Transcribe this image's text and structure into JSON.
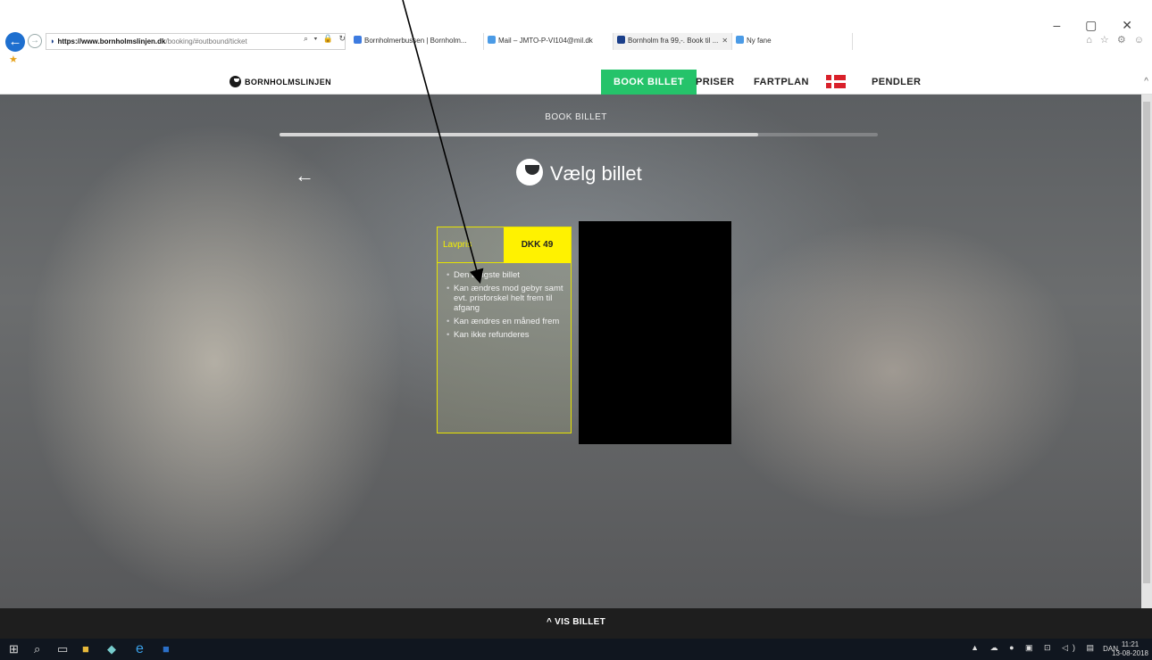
{
  "browser": {
    "url_domain": "https://www.bornholmslinjen.dk",
    "url_path": "/booking/#outbound/ticket",
    "tabs": [
      {
        "label": "Bornholmerbussen | Bornholm...",
        "color": "#3d7be0"
      },
      {
        "label": "Mail – JMTO-P-VI104@mil.dk",
        "color": "#4b9be6"
      },
      {
        "label": "Bornholm fra 99,-. Book til ...",
        "color": "#1a3f8a"
      },
      {
        "label": "Ny fane",
        "color": "#4b9be6"
      }
    ],
    "window_controls": "– ▢ ✕",
    "tool_icons": "⌂ ☆ ⚙ ☺",
    "address_tools": "⌕ ▾ 🔒 ↻"
  },
  "site": {
    "logo_text": "BORNHOLMSLINJEN",
    "nav": [
      {
        "label": "BOOK BILLET",
        "active": true
      },
      {
        "label": "PRISER",
        "active": false
      },
      {
        "label": "FARTPLAN",
        "active": false
      },
      {
        "label": "PENDLER",
        "active": false
      }
    ],
    "step_label": "BOOK BILLET",
    "progress": 0.8,
    "back_arrow": "←",
    "page_title": "Vælg billet",
    "ticket": {
      "name": "Lavpris",
      "price": "DKK 49",
      "features": [
        "Den billigste billet",
        "Kan ændres mod gebyr samt evt. prisforskel helt frem til afgang",
        "Kan ændres en måned frem",
        "Kan ikke refunderes"
      ]
    },
    "bottom_bar": "^ VIS BILLET"
  },
  "colors": {
    "accent_green": "#25c36a",
    "ticket_yellow": "#fff200"
  },
  "taskbar": {
    "icons": [
      "windows-icon",
      "search-icon",
      "task-view-icon",
      "file-explorer-icon",
      "app-icon",
      "internet-explorer-icon",
      "word-icon"
    ],
    "tray": "▲ ☁ ● ▣ ⊡ ◁) ▤",
    "language": "DAN",
    "time": "11:21",
    "date": "13-08-2018"
  }
}
